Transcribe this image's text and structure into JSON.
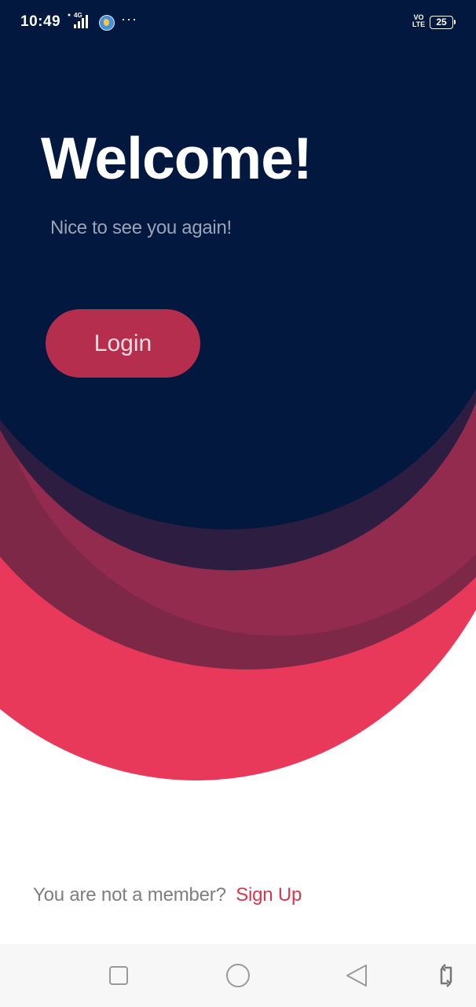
{
  "status_bar": {
    "time": "10:49",
    "network": "4G",
    "more": "···",
    "volte": "VO LTE",
    "battery": "25"
  },
  "welcome": {
    "title": "Welcome!",
    "subtitle": "Nice to see you again!"
  },
  "login": {
    "button_label": "Login"
  },
  "signup": {
    "prompt": "You are not a member?",
    "link_label": "Sign Up"
  },
  "nav_bar": {
    "icons": [
      "recent-apps-icon",
      "home-icon",
      "back-icon",
      "rotate-screen-icon"
    ]
  },
  "colors": {
    "navy": "#02183e",
    "crimson": "#e8395a",
    "button": "#b62e4d",
    "link": "#d8364f"
  }
}
